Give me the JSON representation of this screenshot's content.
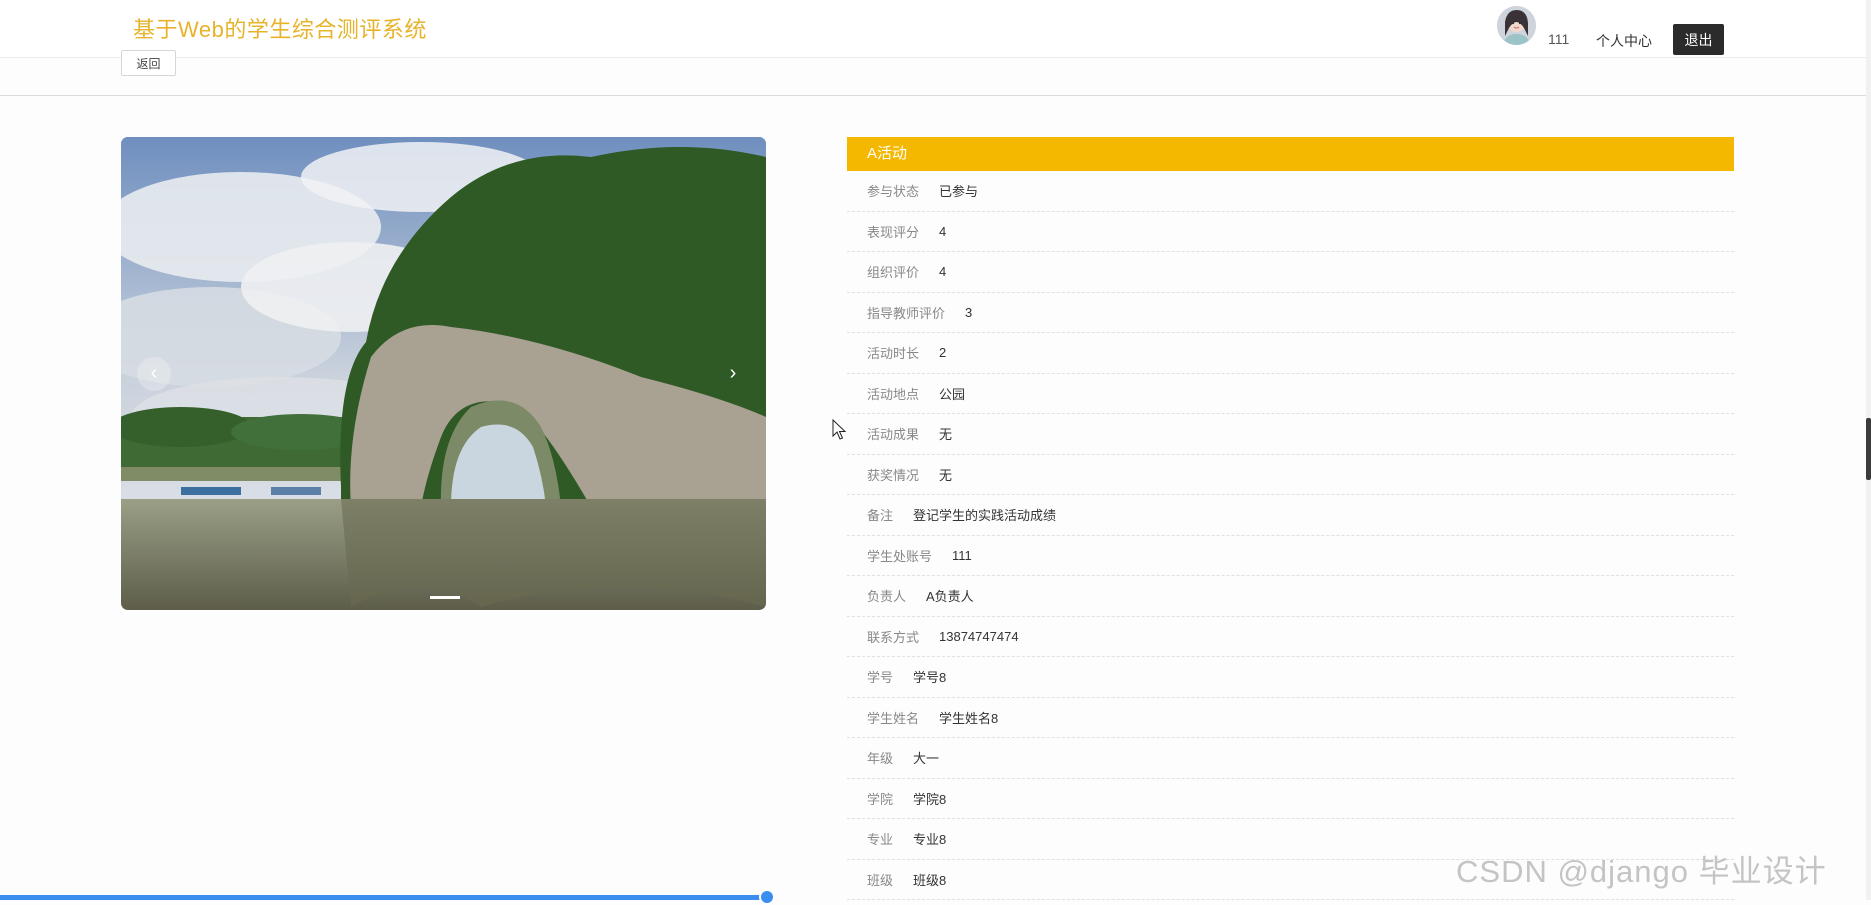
{
  "header": {
    "site_title": "基于Web的学生综合测评系统",
    "username": "111",
    "personal_center": "个人中心",
    "logout": "退出"
  },
  "toolbar": {
    "back": "返回"
  },
  "carousel": {
    "prev": "‹",
    "next": "›",
    "slide_count": 1,
    "active_index": 0
  },
  "detail": {
    "title": "A活动",
    "fields": [
      {
        "label": "参与状态",
        "value": "已参与"
      },
      {
        "label": "表现评分",
        "value": "4"
      },
      {
        "label": "组织评价",
        "value": "4"
      },
      {
        "label": "指导教师评价",
        "value": "3"
      },
      {
        "label": "活动时长",
        "value": "2"
      },
      {
        "label": "活动地点",
        "value": "公园"
      },
      {
        "label": "活动成果",
        "value": "无"
      },
      {
        "label": "获奖情况",
        "value": "无"
      },
      {
        "label": "备注",
        "value": "登记学生的实践活动成绩"
      },
      {
        "label": "学生处账号",
        "value": "111"
      },
      {
        "label": "负责人",
        "value": "A负责人"
      },
      {
        "label": "联系方式",
        "value": "13874747474"
      },
      {
        "label": "学号",
        "value": "学号8"
      },
      {
        "label": "学生姓名",
        "value": "学生姓名8"
      },
      {
        "label": "年级",
        "value": "大一"
      },
      {
        "label": "学院",
        "value": "学院8"
      },
      {
        "label": "专业",
        "value": "专业8"
      },
      {
        "label": "班级",
        "value": "班级8"
      }
    ]
  },
  "video": {
    "progress": 0.41
  },
  "watermark": "CSDN @django 毕业设计",
  "colors": {
    "brand_title": "#e6b32a",
    "header_band": "#f4b800",
    "logout_bg": "#2b2b2b",
    "progress": "#3a8ef0"
  }
}
